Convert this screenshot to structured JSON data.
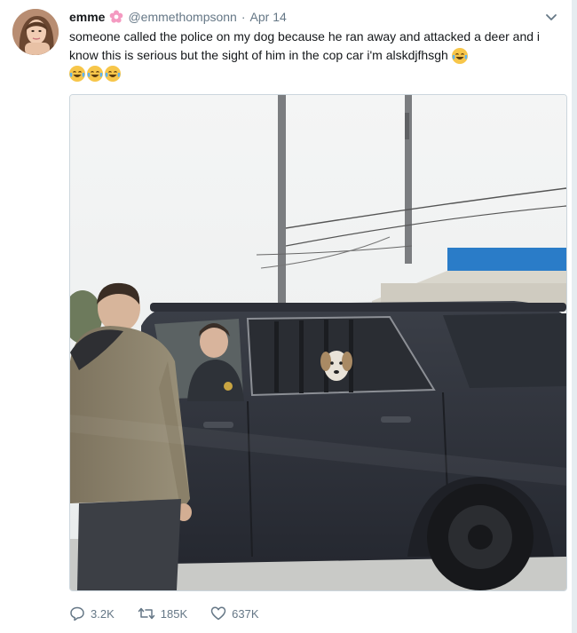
{
  "tweet": {
    "display_name": "emme",
    "handle": "@emmethompsonn",
    "separator": "·",
    "date": "Apr 14",
    "text": "someone called the police on my dog because he ran away and attacked a deer and i know this is serious but the sight of him in the cop car i'm alskdjfhsgh",
    "emojis": [
      "crying-laughing-emoji",
      "crying-laughing-emoji",
      "crying-laughing-emoji",
      "crying-laughing-emoji"
    ]
  },
  "actions": {
    "reply_count": "3.2K",
    "retweet_count": "185K",
    "like_count": "637K"
  },
  "icons": {
    "verified_flower": "flower-icon",
    "menu": "chevron-down-icon",
    "reply": "reply-icon",
    "retweet": "retweet-icon",
    "like": "heart-icon"
  },
  "colors": {
    "text_primary": "#14171a",
    "text_secondary": "#657786",
    "border": "#ccd6dd",
    "flower_pink": "#f49ac1"
  }
}
